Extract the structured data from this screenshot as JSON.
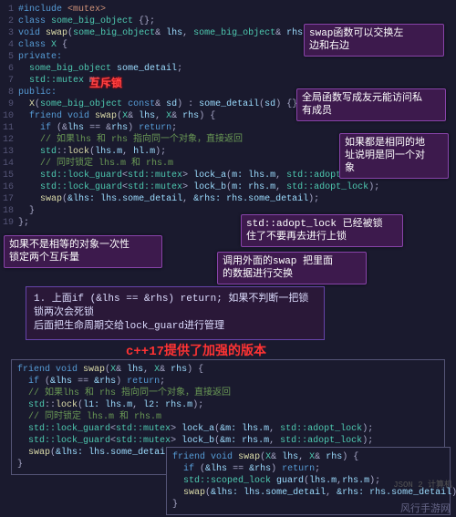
{
  "lines": [
    {
      "n": "1",
      "html": "<span class='kw'>#include</span> <span class='str'>&lt;mutex&gt;</span>"
    },
    {
      "n": "2",
      "html": "<span class='kw'>class</span> <span class='type'>some_big_object</span> {};"
    },
    {
      "n": "3",
      "html": "<span class='kw'>void</span> <span class='fn'>swap</span>(<span class='type'>some_big_object</span>&amp; <span class='ident'>lhs</span>, <span class='type'>some_big_object</span>&amp; <span class='ident'>rhs</span>);"
    },
    {
      "n": "4",
      "html": "<span class='kw'>class</span> <span class='type'>X</span> {"
    },
    {
      "n": "5",
      "html": "<span class='kw'>private:</span>"
    },
    {
      "n": "6",
      "html": "  <span class='type'>some_big_object</span> <span class='ident'>some_detail</span>;"
    },
    {
      "n": "7",
      "html": "  <span class='type'>std::mutex</span> <span class='ident'>m</span>;"
    },
    {
      "n": "8",
      "html": "<span class='kw'>public:</span>"
    },
    {
      "n": "9",
      "html": "  <span class='fn'>X</span>(<span class='type'>some_big_object</span> <span class='kw'>const</span>&amp; <span class='ident'>sd</span>) : <span class='ident'>some_detail</span>(<span class='ident'>sd</span>) {}"
    },
    {
      "n": "10",
      "html": "  <span class='kw'>friend void</span> <span class='fn'>swap</span>(<span class='type'>X</span>&amp; <span class='ident'>lhs</span>, <span class='type'>X</span>&amp; <span class='ident'>rhs</span>) {"
    },
    {
      "n": "11",
      "html": "    <span class='kw'>if</span> (&amp;<span class='ident'>lhs</span> == &amp;<span class='ident'>rhs</span>) <span class='kw'>return</span>;"
    },
    {
      "n": "12",
      "html": "    <span class='cmt'>// 如果lhs 和 rhs 指向同一个对象，直接返回</span>"
    },
    {
      "n": "13",
      "html": "    <span class='type'>std</span>::<span class='fn'>lock</span>(<span class='ident'>lhs.m</span>, <span class='ident'>hl.m</span>);"
    },
    {
      "n": "14",
      "html": "    <span class='cmt'>// 同时锁定 lhs.m 和 rhs.m</span>"
    },
    {
      "n": "15",
      "html": "    <span class='type'>std::lock_guard</span>&lt;<span class='type'>std::mutex</span>&gt; <span class='ident'>lock_a</span>(<span class='ident'>m:</span> <span class='ident'>lhs.m</span>, <span class='type'>std::adopt_lock</span>);"
    },
    {
      "n": "16",
      "html": "    <span class='type'>std::lock_guard</span>&lt;<span class='type'>std::mutex</span>&gt; <span class='ident'>lock_b</span>(<span class='ident'>m:</span> <span class='ident'>rhs.m</span>, <span class='type'>std::adopt_lock</span>);"
    },
    {
      "n": "17",
      "html": "    <span class='fn'>swap</span>(<span class='ident'>&amp;lhs:</span> <span class='ident'>lhs.some_detail</span>, <span class='ident'>&amp;rhs:</span> <span class='ident'>rhs.some_detail</span>);"
    },
    {
      "n": "18",
      "html": "  }"
    },
    {
      "n": "19",
      "html": "};"
    }
  ],
  "anno_mutex": "互斥锁",
  "callouts": {
    "c1": "swap函数可以交换左\n边和右边",
    "c2": "全局函数写成友元能访问私\n有成员",
    "c3": "如果都是相同的地\n址说明是同一个对\n象",
    "c4": "std::adopt_lock 已经被锁\n住了不要再去进行上锁",
    "c5": "调用外面的swap 把里面\n的数据进行交换",
    "c6": "如果不是相等的对象一次性\n锁定两个互斥量"
  },
  "note": "1. 上面if (&lhs == &rhs) return; 如果不判断一把锁\n锁两次会死锁\n后面把生命周期交给lock_guard进行管理",
  "section_title": "c++17提供了加强的版本",
  "box2_lines": [
    "<span class='kw'>friend void</span> <span class='fn'>swap</span>(<span class='type'>X</span>&amp; <span class='ident'>lhs</span>, <span class='type'>X</span>&amp; <span class='ident'>rhs</span>) {",
    "  <span class='kw'>if</span> (<span class='ident'>&amp;lhs</span> == <span class='ident'>&amp;rhs</span>) <span class='kw'>return</span>;",
    "  <span class='cmt'>// 如果lhs 和 rhs 指向同一个对象，直接返回</span>",
    "  <span class='type'>std</span>::<span class='fn'>lock</span>(<span class='ident'>l1:</span> <span class='ident'>lhs.m</span>, <span class='ident'>l2:</span> <span class='ident'>rhs.m</span>);",
    "  <span class='cmt'>// 同时锁定 lhs.m 和 rhs.m</span>",
    "  <span class='type'>std::lock_guard</span>&lt;<span class='type'>std::mutex</span>&gt; <span class='ident'>lock_a</span>(<span class='ident'>&amp;m:</span> <span class='ident'>lhs.m</span>, <span class='type'>std::adopt_lock</span>);",
    "  <span class='type'>std::lock_guard</span>&lt;<span class='type'>std::mutex</span>&gt; <span class='ident'>lock_b</span>(<span class='ident'>&amp;m:</span> <span class='ident'>rhs.m</span>, <span class='type'>std::adopt_lock</span>);",
    "  <span class='fn'>swap</span>(<span class='ident'>&amp;lhs:</span> <span class='ident'>lhs.some_detail</span>, <span class='ident'>&amp;rhs:</span> <span class='ident'>rhs.some_detail</span>);",
    "}"
  ],
  "box3_lines": [
    "<span class='kw'>friend</span> <span class='kw'>void</span> <span class='fn'>swap</span>(<span class='type'>X</span>&amp; <span class='ident'>lhs</span>, <span class='type'>X</span>&amp; <span class='ident'>rhs</span>) {",
    "  <span class='kw'>if</span> (<span class='ident'>&amp;lhs</span> == <span class='ident'>&amp;rhs</span>) <span class='kw'>return</span>;",
    "  <span class='type'>std::scoped_lock</span> <span class='ident'>guard</span>(<span class='ident'>lhs.m</span>,<span class='ident'>rhs.m</span>);",
    "  <span class='fn'>swap</span>(<span class='ident'>&amp;lhs:</span> <span class='ident'>lhs.some_detail</span>, <span class='ident'>&amp;rhs:</span> <span class='ident'>rhs.some_detail</span>);",
    "}"
  ],
  "watermark": "风行手游网",
  "csdn": "JSON 2 计算机"
}
